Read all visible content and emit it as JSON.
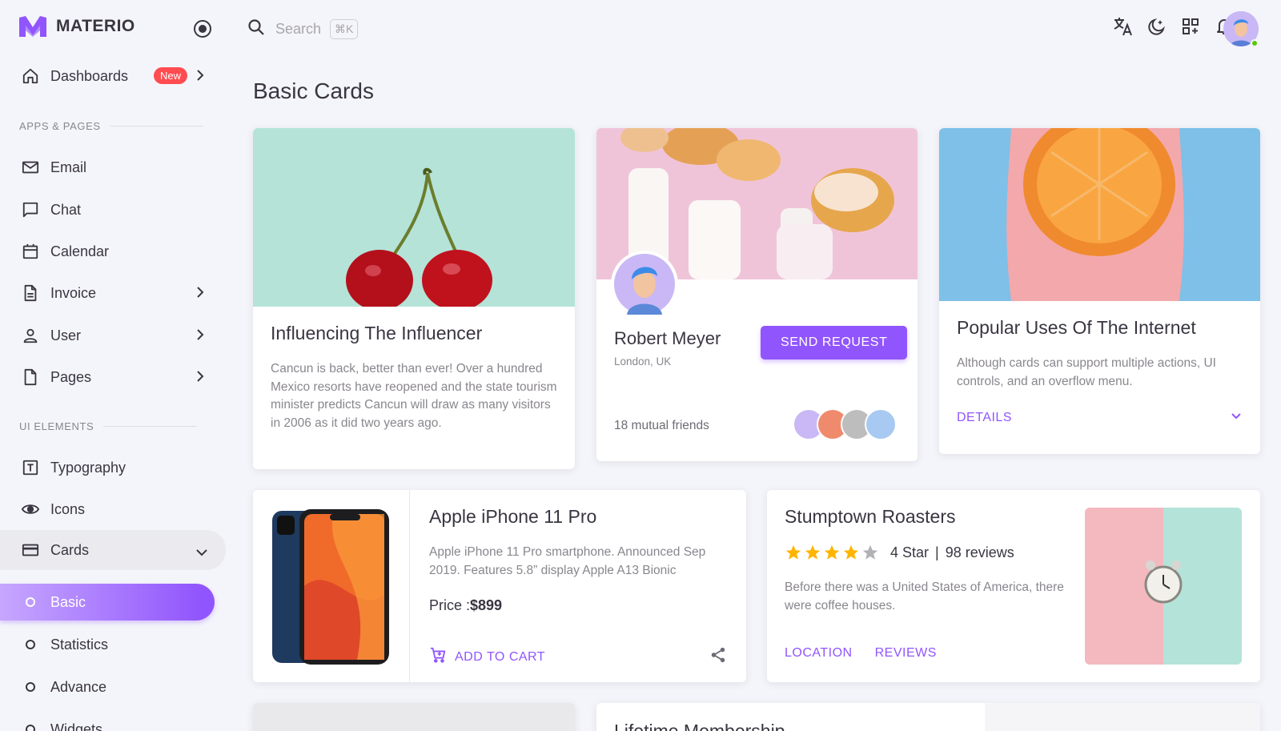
{
  "brand": {
    "name": "MATERIO"
  },
  "sidebar": {
    "dashboards": {
      "label": "Dashboards",
      "badge": "New"
    },
    "section_apps": "APPS & PAGES",
    "apps": [
      {
        "label": "Email"
      },
      {
        "label": "Chat"
      },
      {
        "label": "Calendar"
      },
      {
        "label": "Invoice"
      },
      {
        "label": "User"
      },
      {
        "label": "Pages"
      }
    ],
    "section_ui": "UI ELEMENTS",
    "ui": [
      {
        "label": "Typography"
      },
      {
        "label": "Icons"
      },
      {
        "label": "Cards"
      }
    ],
    "cards_sub": [
      {
        "label": "Basic"
      },
      {
        "label": "Statistics"
      },
      {
        "label": "Advance"
      },
      {
        "label": "Widgets"
      }
    ]
  },
  "topbar": {
    "search_placeholder": "Search",
    "shortcut": "⌘K"
  },
  "page": {
    "title": "Basic Cards"
  },
  "cards": {
    "influencer": {
      "title": "Influencing The Influencer",
      "text": "Cancun is back, better than ever! Over a hundred Mexico resorts have reopened and the state tourism minister predicts Cancun will draw as many visitors in 2006 as it did two years ago."
    },
    "profile": {
      "name": "Robert Meyer",
      "location": "London, UK",
      "button": "SEND REQUEST",
      "friends": "18 mutual friends"
    },
    "internet": {
      "title": "Popular Uses Of The Internet",
      "text": "Although cards can support multiple actions, UI controls, and an overflow menu.",
      "action": "DETAILS"
    },
    "iphone": {
      "title": "Apple iPhone 11 Pro",
      "text": "Apple iPhone 11 Pro smartphone. Announced Sep 2019. Features 5.8” display Apple A13 Bionic",
      "price_label": "Price :",
      "price": "$899",
      "action": "ADD TO CART"
    },
    "stumptown": {
      "title": "Stumptown Roasters",
      "rating_text": "4 Star",
      "reviews": "98 reviews",
      "rating": 4,
      "text": "Before there was a United States of America, there were coffee houses.",
      "action1": "LOCATION",
      "action2": "REVIEWS"
    },
    "membership": {
      "title": "Lifetime Membership"
    }
  },
  "colors": {
    "primary": "#9155fd",
    "error": "#ff4c51",
    "success": "#56ca00",
    "star": "#ffb400"
  }
}
